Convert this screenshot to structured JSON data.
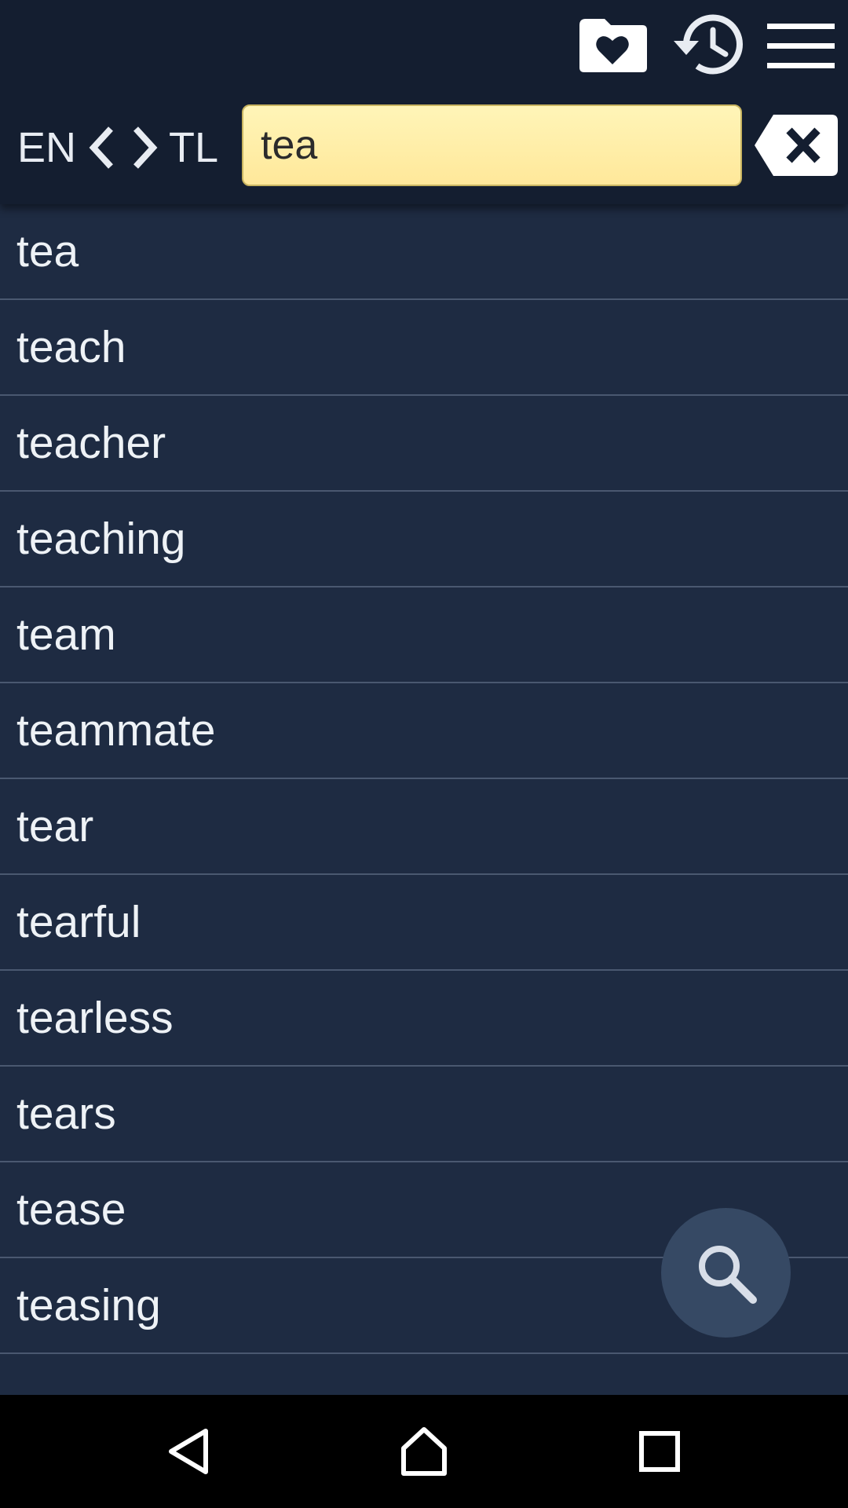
{
  "header": {
    "source_lang": "EN",
    "target_lang": "TL",
    "search_value": "tea"
  },
  "icons": {
    "favorites": "folder-heart-icon",
    "history": "history-icon",
    "menu": "hamburger-menu-icon",
    "clear": "backspace-clear-icon",
    "search_fab": "search-icon"
  },
  "results": [
    "tea",
    "teach",
    "teacher",
    "teaching",
    "team",
    "teammate",
    "tear",
    "tearful",
    "tearless",
    "tears",
    "tease",
    "teasing"
  ],
  "colors": {
    "topbar": "#141e30",
    "list_bg": "#1e2b42",
    "search_bg": "#ffefaa",
    "fab": "#364964"
  }
}
